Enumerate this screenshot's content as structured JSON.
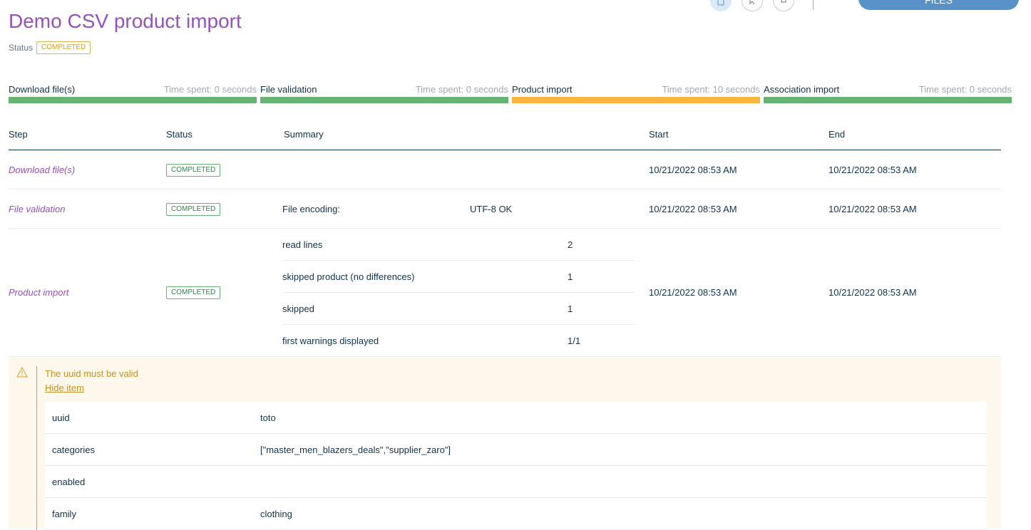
{
  "header": {
    "title": "Demo CSV product import",
    "status_label": "Status",
    "status_value": "COMPLETED",
    "download_button": "Download generated files"
  },
  "steps": [
    {
      "name": "Download file(s)",
      "time": "Time spent: 0 seconds",
      "color": "#67b373"
    },
    {
      "name": "File validation",
      "time": "Time spent: 0 seconds",
      "color": "#67b373"
    },
    {
      "name": "Product import",
      "time": "Time spent: 10 seconds",
      "color": "#f9b53f"
    },
    {
      "name": "Association import",
      "time": "Time spent: 0 seconds",
      "color": "#67b373"
    }
  ],
  "table": {
    "headers": {
      "step": "Step",
      "status": "Status",
      "summary": "Summary",
      "start": "Start",
      "end": "End"
    },
    "rows": [
      {
        "step": "Download file(s)",
        "status": "COMPLETED",
        "start": "10/21/2022 08:53 AM",
        "end": "10/21/2022 08:53 AM"
      },
      {
        "step": "File validation",
        "status": "COMPLETED",
        "summary_label": "File encoding:",
        "summary_value": "UTF-8 OK",
        "start": "10/21/2022 08:53 AM",
        "end": "10/21/2022 08:53 AM"
      },
      {
        "step": "Product import",
        "status": "COMPLETED",
        "summary": [
          {
            "label": "read lines",
            "value": "2"
          },
          {
            "label": "skipped product (no differences)",
            "value": "1"
          },
          {
            "label": "skipped",
            "value": "1"
          },
          {
            "label": "first warnings displayed",
            "value": "1/1"
          }
        ],
        "start": "10/21/2022 08:53 AM",
        "end": "10/21/2022 08:53 AM"
      }
    ]
  },
  "warning": {
    "message": "The uuid must be valid",
    "hide_link": "Hide item",
    "attributes": [
      {
        "name": "uuid",
        "value": "toto"
      },
      {
        "name": "categories",
        "value": "[\"master_men_blazers_deals\",\"supplier_zaro\"]"
      },
      {
        "name": "enabled",
        "value": ""
      },
      {
        "name": "family",
        "value": "clothing"
      }
    ]
  },
  "icons": [
    "mobile-icon",
    "cursor-icon",
    "bell-icon",
    "warning-icon"
  ]
}
